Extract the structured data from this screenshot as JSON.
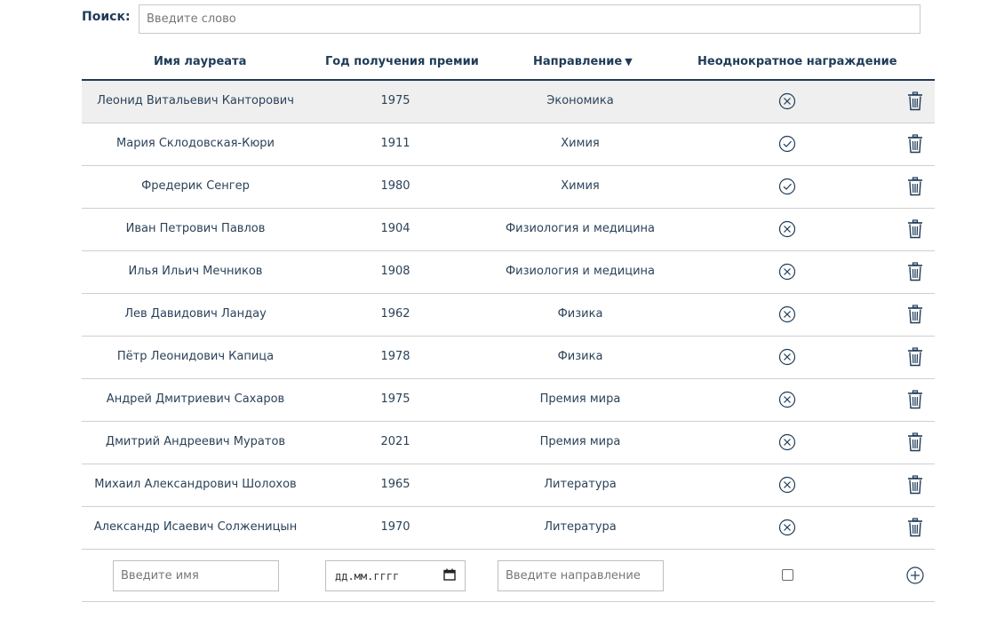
{
  "search": {
    "label": "Поиск:",
    "placeholder": "Введите слово",
    "value": ""
  },
  "table": {
    "headers": {
      "name": "Имя лауреата",
      "year": "Год получения премии",
      "field": "Направление",
      "sort_indicator": "▼",
      "repeat": "Неоднократное награждение"
    },
    "rows": [
      {
        "name": "Леонид Витальевич Канторович",
        "year": "1975",
        "field": "Экономика",
        "repeat": false,
        "highlighted": true
      },
      {
        "name": "Мария Склодовская-Кюри",
        "year": "1911",
        "field": "Химия",
        "repeat": true
      },
      {
        "name": "Фредерик Сенгер",
        "year": "1980",
        "field": "Химия",
        "repeat": true
      },
      {
        "name": "Иван Петрович Павлов",
        "year": "1904",
        "field": "Физиология и медицина",
        "repeat": false
      },
      {
        "name": "Илья Ильич Мечников",
        "year": "1908",
        "field": "Физиология и медицина",
        "repeat": false
      },
      {
        "name": "Лев Давидович Ландау",
        "year": "1962",
        "field": "Физика",
        "repeat": false
      },
      {
        "name": "Пётр Леонидович Капица",
        "year": "1978",
        "field": "Физика",
        "repeat": false
      },
      {
        "name": "Андрей Дмитриевич Сахаров",
        "year": "1975",
        "field": "Премия мира",
        "repeat": false
      },
      {
        "name": "Дмитрий Андреевич Муратов",
        "year": "2021",
        "field": "Премия мира",
        "repeat": false
      },
      {
        "name": "Михаил Александрович Шолохов",
        "year": "1965",
        "field": "Литература",
        "repeat": false
      },
      {
        "name": "Александр Исаевич Солженицын",
        "year": "1970",
        "field": "Литература",
        "repeat": false
      }
    ],
    "icons": {
      "repeat_yes": "check-circle-icon",
      "repeat_no": "x-circle-icon",
      "delete": "trash-icon",
      "add": "plus-circle-icon"
    }
  },
  "add_form": {
    "name_placeholder": "Введите имя",
    "date_placeholder": "дд.мм.гггг",
    "field_placeholder": "Введите направление",
    "repeat_checked": false
  },
  "colors": {
    "text": "#1f3b57",
    "highlight_row": "#efefef",
    "border": "#cfcfcf"
  }
}
